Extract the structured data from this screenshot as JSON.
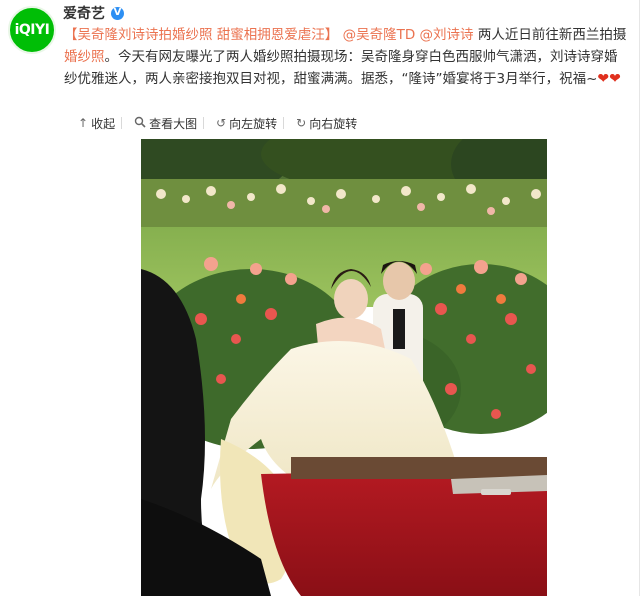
{
  "user": {
    "name": "爱奇艺",
    "avatar_text": "iQIYI",
    "verified": "V"
  },
  "post": {
    "hashtag": "【吴奇隆刘诗诗拍婚纱照 甜蜜相拥恩爱虐汪】",
    "mention1": "@吴奇隆TD",
    "mention2": "@刘诗诗",
    "line1_tail": "两人近日前往新西兰拍摄",
    "link_word": "婚纱照",
    "line2": "。今天有网友曝光了两人婚纱照拍摄现场：吴奇隆身穿白色西服帅气潇洒，刘诗诗穿婚纱优雅迷人，两人亲密接抱双目对视，甜蜜满满。据悉，“隆诗”婚宴将于3月举行，祝福~",
    "hearts": "❤❤",
    "link_color": "#eb7350"
  },
  "toolbar": {
    "collapse": {
      "icon": "↑",
      "label": "收起"
    },
    "view_large": {
      "icon": "🔍",
      "label": "查看大图"
    },
    "rotate_left": {
      "icon": "↺",
      "label": "向左旋转"
    },
    "rotate_right": {
      "icon": "↻",
      "label": "向右旋转"
    }
  },
  "colors": {
    "avatar_bg": "#00be06",
    "verified_bg": "#2d8ff3",
    "accent": "#eb7350"
  },
  "photo": {
    "alt": "吴奇隆刘诗诗婚纱照"
  }
}
